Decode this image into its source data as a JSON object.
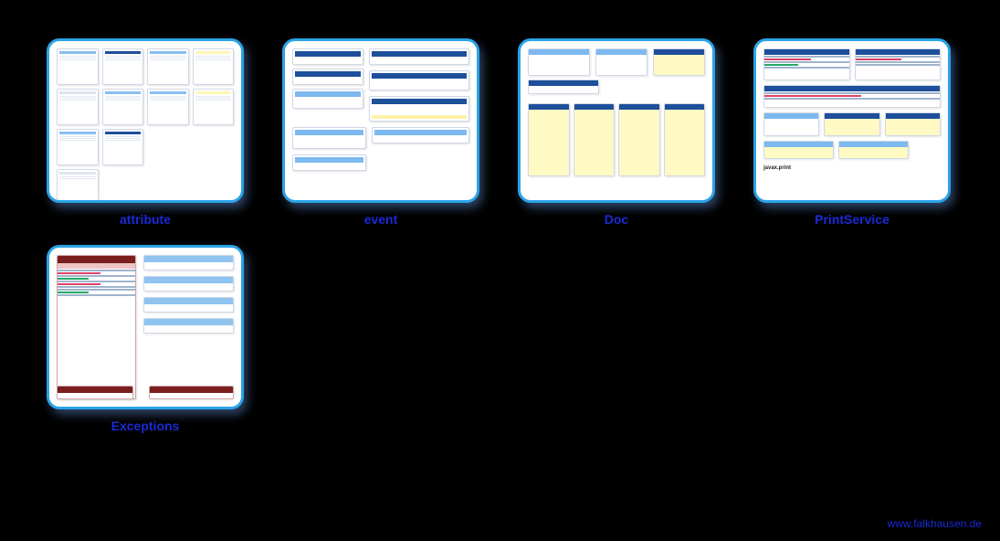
{
  "thumbnails": [
    {
      "id": "attribute",
      "label": "attribute"
    },
    {
      "id": "event",
      "label": "event"
    },
    {
      "id": "doc",
      "label": "Doc"
    },
    {
      "id": "printservice",
      "label": "PrintService"
    },
    {
      "id": "exceptions",
      "label": "Exceptions"
    }
  ],
  "footer": {
    "url_text": "www.falkhausen.de"
  },
  "printservice_package_hint": "javax.print"
}
